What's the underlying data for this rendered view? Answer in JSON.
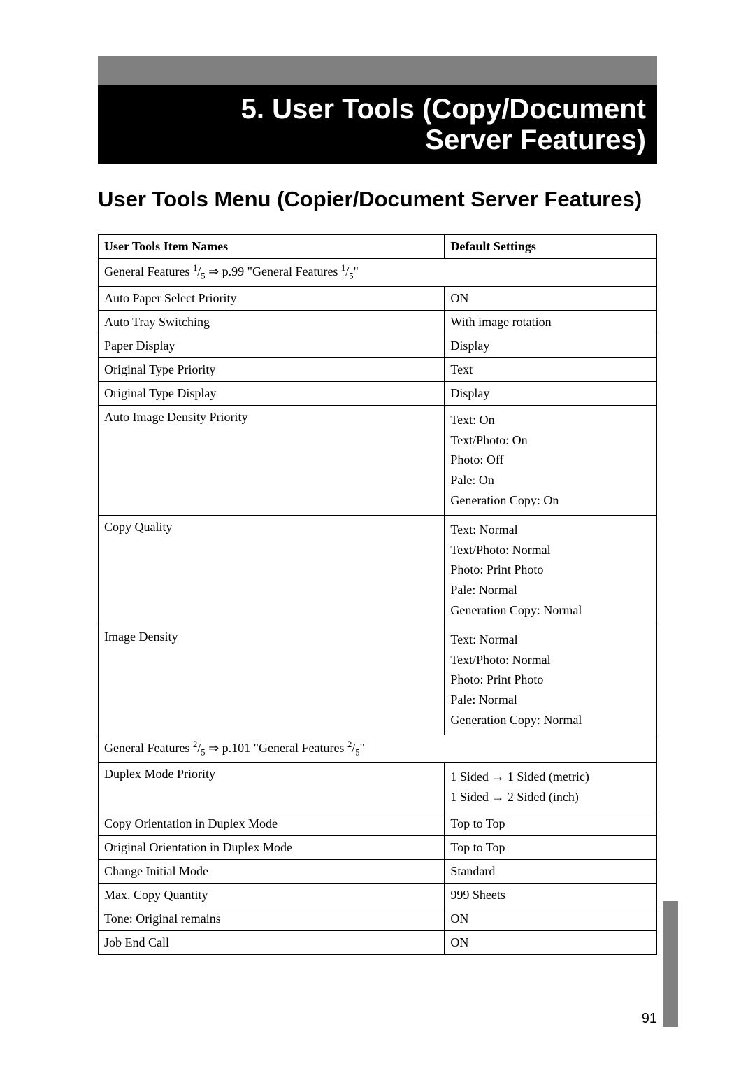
{
  "chapter": {
    "number": "5.",
    "title_line1": "5. User Tools (Copy/Document",
    "title_line2": "Server Features)"
  },
  "section_title": "User Tools Menu (Copier/Document Server Features)",
  "table": {
    "header_col1": "User Tools Item Names",
    "header_col2": "Default Settings",
    "group1_prefix": "General Features ",
    "group1_sup1": "1",
    "group1_sub1": "5",
    "group1_mid": " ⇒ p.99 \"General Features ",
    "group1_sup2": "1",
    "group1_sub2": "5",
    "group1_end": "\"",
    "rows1": [
      {
        "name": "Auto Paper Select Priority",
        "value": "ON"
      },
      {
        "name": "Auto Tray Switching",
        "value": "With image rotation"
      },
      {
        "name": "Paper Display",
        "value": "Display"
      },
      {
        "name": "Original Type Priority",
        "value": "Text"
      },
      {
        "name": "Original Type Display",
        "value": "Display"
      }
    ],
    "row_density": {
      "name": "Auto Image Density Priority",
      "l1": "Text: On",
      "l2": "Text/Photo: On",
      "l3": "Photo: Off",
      "l4": "Pale: On",
      "l5": "Generation Copy: On"
    },
    "row_quality": {
      "name": "Copy Quality",
      "l1": "Text: Normal",
      "l2": "Text/Photo: Normal",
      "l3": "Photo: Print Photo",
      "l4": "Pale: Normal",
      "l5": "Generation Copy: Normal"
    },
    "row_image_density": {
      "name": "Image Density",
      "l1": "Text: Normal",
      "l2": "Text/Photo: Normal",
      "l3": "Photo: Print Photo",
      "l4": "Pale: Normal",
      "l5": "Generation Copy: Normal"
    },
    "group2_prefix": "General Features ",
    "group2_sup1": "2",
    "group2_sub1": "5",
    "group2_mid": " ⇒ p.101 \"General Features ",
    "group2_sup2": "2",
    "group2_sub2": "5",
    "group2_end": "\"",
    "row_duplex": {
      "name": "Duplex Mode Priority",
      "l1": "1 Sided → 1 Sided (metric)",
      "l2": "1 Sided → 2 Sided (inch)"
    },
    "rows2": [
      {
        "name": "Copy Orientation in Duplex Mode",
        "value": "Top to Top"
      },
      {
        "name": "Original Orientation in Duplex Mode",
        "value": "Top to Top"
      },
      {
        "name": "Change Initial Mode",
        "value": "Standard"
      },
      {
        "name": "Max. Copy Quantity",
        "value": "999 Sheets"
      },
      {
        "name": "Tone: Original remains",
        "value": "ON"
      },
      {
        "name": "Job End Call",
        "value": "ON"
      }
    ]
  },
  "page_number": "91"
}
